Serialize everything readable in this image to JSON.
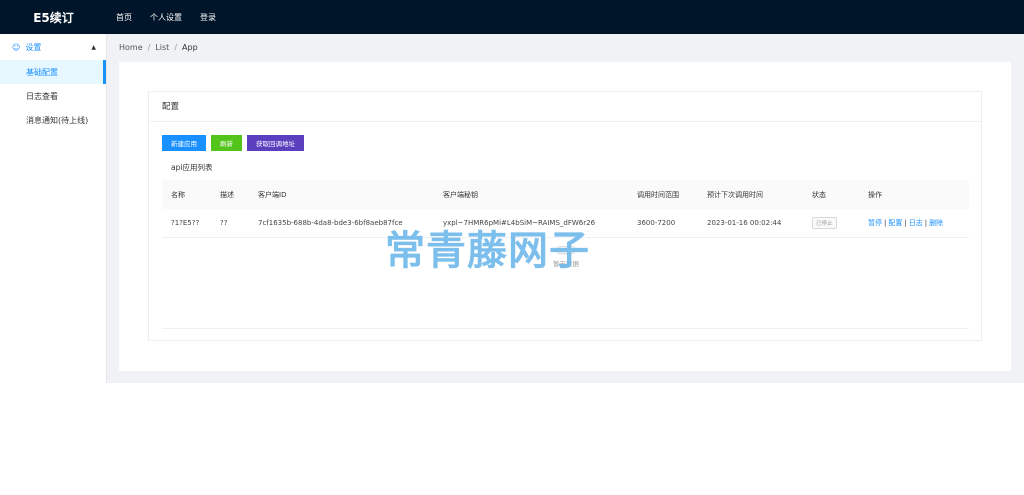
{
  "app": {
    "title": "E5续订"
  },
  "topnav": [
    "首页",
    "个人设置",
    "登录"
  ],
  "sidebar": {
    "group_label": "设置",
    "items": [
      {
        "label": "基础配置",
        "active": true
      },
      {
        "label": "日志查看",
        "active": false
      },
      {
        "label": "消息通知(待上线)",
        "active": false
      }
    ]
  },
  "breadcrumb": [
    "Home",
    "List",
    "App"
  ],
  "card": {
    "title": "配置",
    "buttons": {
      "new_app": "新建应用",
      "refresh": "刷新",
      "get_callback": "获取回调地址"
    },
    "list_label": "api应用列表"
  },
  "table": {
    "headers": [
      "名称",
      "描述",
      "客户端ID",
      "客户端秘钥",
      "调用时间范围",
      "预计下次调用时间",
      "状态",
      "操作"
    ],
    "rows": [
      {
        "name": "?1?E5??",
        "desc": "??",
        "client_id": "7cf1635b-688b-4da8-bde3-6bf8aeb87fce",
        "client_secret": "yxpl~7HMR6pMi#L4bSiM~RAIMS_dFW6r26",
        "range": "3600-7200",
        "next_time": "2023-01-16 00:02:44",
        "status": "已停止",
        "ops": [
          "暂停",
          "配置",
          "日志",
          "删除"
        ]
      }
    ],
    "empty_text": "暂无数据"
  },
  "watermark": "常青藤网子",
  "colors": {
    "header_bg": "#001529",
    "accent": "#1890ff",
    "green": "#52c41a",
    "purple": "#5b3fbf"
  },
  "icons": {
    "sidebar_group": "user-icon",
    "sidebar_toggle": "chevron-up-icon",
    "empty": "empty-box-icon"
  }
}
